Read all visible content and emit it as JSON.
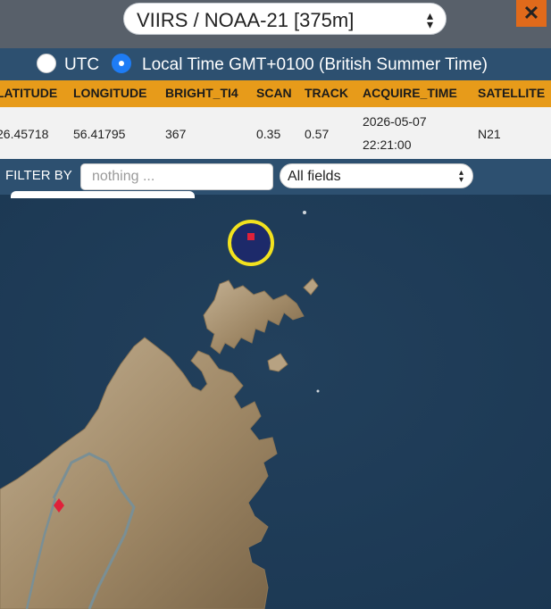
{
  "header": {
    "dataset_select_value": "VIIRS / NOAA-21 [375m]",
    "close_label": "✕"
  },
  "time_options": {
    "utc_label": "UTC",
    "local_label": "Local Time GMT+0100 (British Summer Time)",
    "selected": "local"
  },
  "table": {
    "columns": [
      "LATITUDE",
      "LONGITUDE",
      "BRIGHT_TI4",
      "SCAN",
      "TRACK",
      "ACQUIRE_TIME",
      "SATELLITE"
    ],
    "row": {
      "latitude": "26.45718",
      "longitude": "56.41795",
      "bright_ti4": "367",
      "scan": "0.35",
      "track": "0.57",
      "acquire_date": "2026-05-07",
      "acquire_time": "22:21:00",
      "satellite": "N21"
    }
  },
  "filter": {
    "label": "FILTER BY",
    "placeholder": "nothing ...",
    "value": "",
    "field_select_value": "All fields"
  },
  "colors": {
    "header_bar": "#58606a",
    "accent_orange": "#e79b1a",
    "close_orange": "#e06a1b",
    "radio_blue": "#1e7cf5",
    "panel_blue": "#2d5070",
    "sea": "#1e3a55",
    "land": "#a6906e",
    "highlight_ring": "#f2e21e",
    "fire_marker": "#e0213a"
  },
  "icons": {
    "close": "close-icon",
    "select_chevron": "chevron-up-down-icon"
  }
}
